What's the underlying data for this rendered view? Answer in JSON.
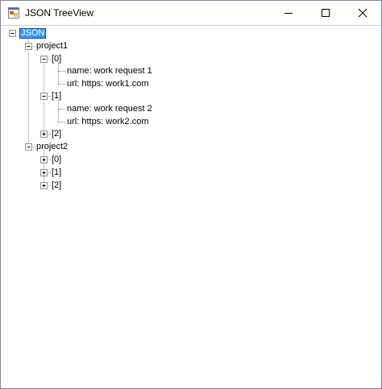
{
  "window": {
    "title": "JSON TreeView"
  },
  "tree": {
    "root": "JSON",
    "project1": {
      "label": "project1",
      "item0": {
        "label": "[0]",
        "name": "name: work request 1",
        "url": "url: https: work1.com"
      },
      "item1": {
        "label": "[1]",
        "name": "name: work request 2",
        "url": "url: https: work2.com"
      },
      "item2": {
        "label": "[2]"
      }
    },
    "project2": {
      "label": "project2",
      "items": [
        "[0]",
        "[1]",
        "[2]"
      ]
    }
  },
  "icons": [
    "app-icon",
    "minimize-icon",
    "maximize-icon",
    "close-icon",
    "collapse-icon",
    "expand-icon"
  ]
}
